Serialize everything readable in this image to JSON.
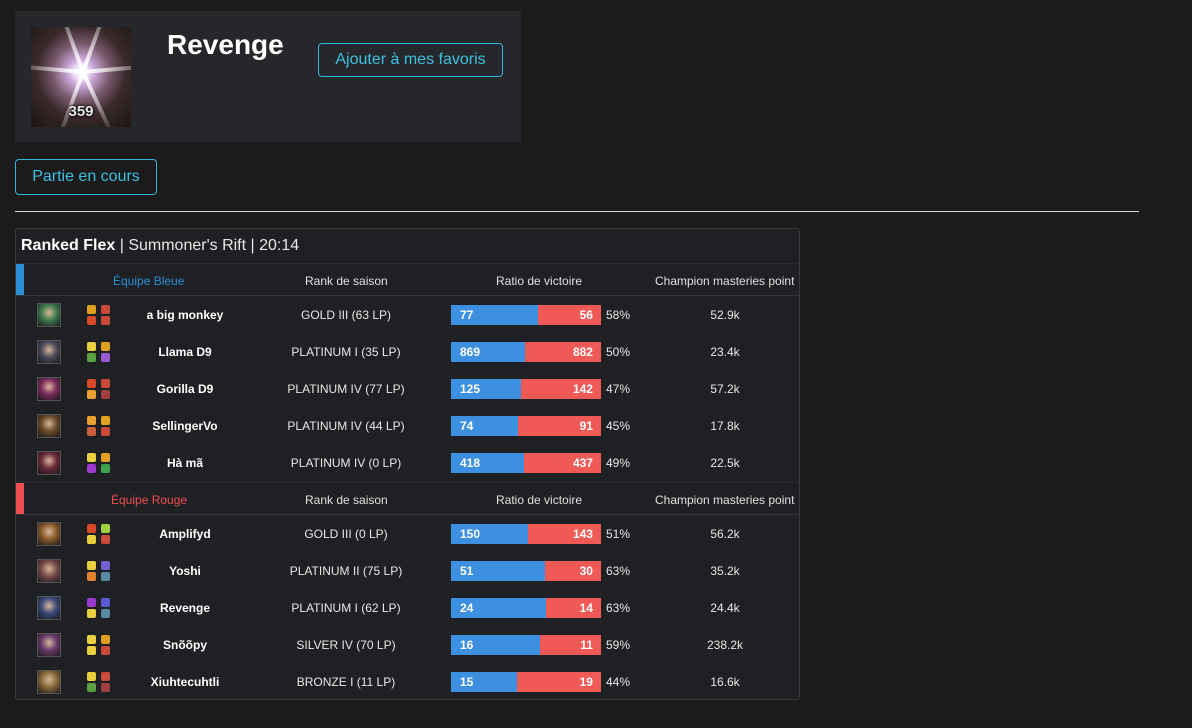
{
  "profile": {
    "name": "Revenge",
    "level": "359",
    "favorite_button": "Ajouter à mes favoris"
  },
  "live_button": "Partie en cours",
  "match": {
    "queue": "Ranked Flex",
    "separator": " | ",
    "map": "Summoner's Rift",
    "duration": "20:14"
  },
  "columns": {
    "rank": "Rank de saison",
    "winrate": "Ratio de victoire",
    "mastery": "Champion masteries point"
  },
  "teams": [
    {
      "name": "Équipe Bleue",
      "color": "#2b8fd6",
      "players": [
        {
          "name": "a big monkey",
          "rank": "GOLD III (63 LP)",
          "wins": "77",
          "losses": "56",
          "pct": "58%",
          "mastery": "52.9k",
          "champ_color": "#3f7a4e",
          "spells": [
            "#e0a020",
            "#c94a3a",
            "#d84a2a",
            "#c94a3a"
          ]
        },
        {
          "name": "Llama D9",
          "rank": "PLATINUM I (35 LP)",
          "wins": "869",
          "losses": "882",
          "pct": "50%",
          "mastery": "23.4k",
          "champ_color": "#4a4a5a",
          "spells": [
            "#e8d040",
            "#e0a020",
            "#5aa040",
            "#9a5ad0"
          ]
        },
        {
          "name": "Gorilla D9",
          "rank": "PLATINUM IV (77 LP)",
          "wins": "125",
          "losses": "142",
          "pct": "47%",
          "mastery": "57.2k",
          "champ_color": "#7a2a5a",
          "spells": [
            "#d84a2a",
            "#c94a3a",
            "#e8a030",
            "#a04040"
          ]
        },
        {
          "name": "SellingerVo",
          "rank": "PLATINUM IV (44 LP)",
          "wins": "74",
          "losses": "91",
          "pct": "45%",
          "mastery": "17.8k",
          "champ_color": "#6a4a2a",
          "spells": [
            "#e8a030",
            "#e0a020",
            "#c9603a",
            "#c94a3a"
          ]
        },
        {
          "name": "Hà mã",
          "rank": "PLATINUM IV (0 LP)",
          "wins": "418",
          "losses": "437",
          "pct": "49%",
          "mastery": "22.5k",
          "champ_color": "#6a2a3a",
          "spells": [
            "#e8d040",
            "#e0a020",
            "#9a3ad0",
            "#40a050"
          ]
        }
      ]
    },
    {
      "name": "Équipe Rouge",
      "color": "#ef4e4e",
      "players": [
        {
          "name": "Amplifyd",
          "rank": "GOLD III (0 LP)",
          "wins": "150",
          "losses": "143",
          "pct": "51%",
          "mastery": "56.2k",
          "champ_color": "#8a5a2a",
          "spells": [
            "#d84a2a",
            "#a0d040",
            "#e8d040",
            "#c94a3a"
          ]
        },
        {
          "name": "Yoshi",
          "rank": "PLATINUM II (75 LP)",
          "wins": "51",
          "losses": "30",
          "pct": "63%",
          "mastery": "35.2k",
          "champ_color": "#7a4a4a",
          "spells": [
            "#e8d040",
            "#7060d0",
            "#e08030",
            "#5a8aa0"
          ]
        },
        {
          "name": "Revenge",
          "rank": "PLATINUM I (62 LP)",
          "wins": "24",
          "losses": "14",
          "pct": "63%",
          "mastery": "24.4k",
          "champ_color": "#3a4a7a",
          "spells": [
            "#9a3ad0",
            "#5a5ad0",
            "#e8d040",
            "#5a8aa0"
          ]
        },
        {
          "name": "Snõõpy",
          "rank": "SILVER IV (70 LP)",
          "wins": "16",
          "losses": "11",
          "pct": "59%",
          "mastery": "238.2k",
          "champ_color": "#6a3a6a",
          "spells": [
            "#e8d040",
            "#e0a020",
            "#e8d040",
            "#c94a3a"
          ]
        },
        {
          "name": "Xiuhtecuhtli",
          "rank": "BRONZE I (11 LP)",
          "wins": "15",
          "losses": "19",
          "pct": "44%",
          "mastery": "16.6k",
          "champ_color": "#8a6a3a",
          "spells": [
            "#e8d040",
            "#c94a3a",
            "#5aa040",
            "#a04040"
          ]
        }
      ]
    }
  ]
}
